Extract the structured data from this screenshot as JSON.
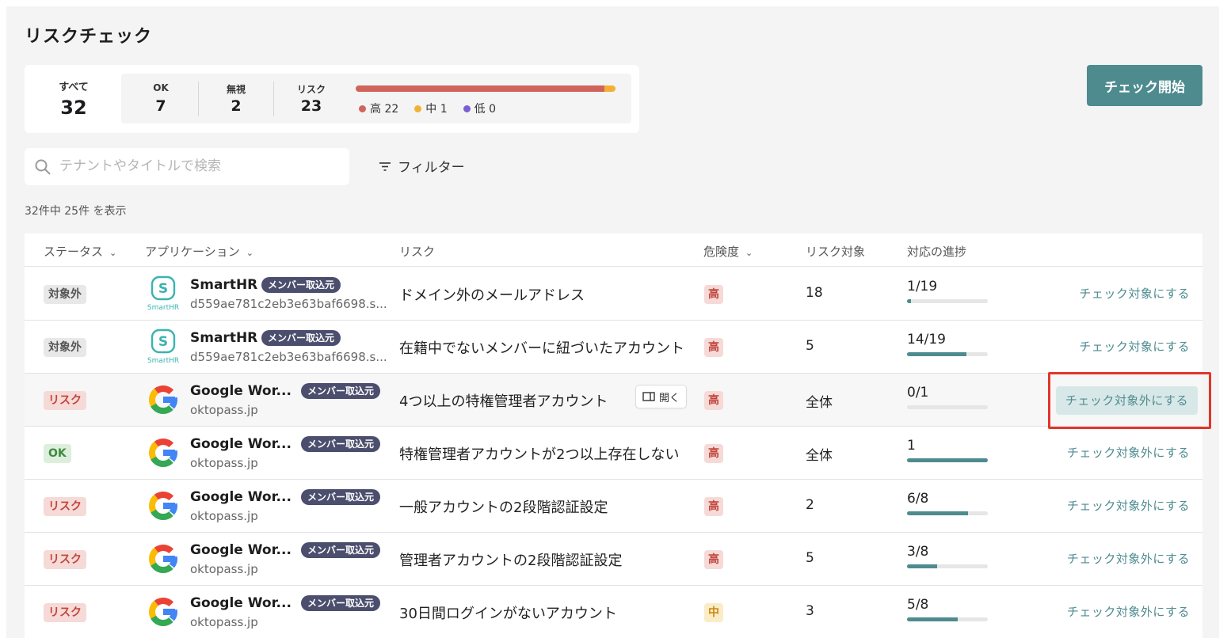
{
  "page": {
    "title": "リスクチェック"
  },
  "summary": {
    "total": {
      "label": "すべて",
      "value": "32"
    },
    "ok": {
      "label": "OK",
      "value": "7"
    },
    "ignored": {
      "label": "無視",
      "value": "2"
    },
    "risk": {
      "label": "リスク",
      "value": "23"
    },
    "risk_breakdown": {
      "high": 22,
      "medium": 1,
      "low": 0
    },
    "legend": {
      "high": "高 22",
      "medium": "中 1",
      "low": "低 0"
    },
    "colors": {
      "high": "#d0645b",
      "medium": "#f2b134",
      "low": "#7a5fd0"
    }
  },
  "toolbar": {
    "start_button": "チェック開始",
    "search_placeholder": "テナントやタイトルで検索",
    "filter_label": "フィルター",
    "result_count": "32件中 25件 を表示"
  },
  "table": {
    "headers": {
      "status": "ステータス",
      "application": "アプリケーション",
      "risk": "リスク",
      "severity": "危険度",
      "target": "リスク対象",
      "progress": "対応の進捗"
    },
    "open_button": "開く",
    "rows": [
      {
        "status": "対象外",
        "status_type": "out",
        "app": "SmartHR",
        "logo": "smarthr",
        "badge": "メンバー取込元",
        "tenant": "d559ae781c2eb3e63baf6698.s...",
        "risk": "ドメイン外のメールアドレス",
        "severity": "高",
        "severity_type": "hi",
        "target": "18",
        "progress": "1/19",
        "progress_ratio": 0.0526,
        "action": "チェック対象にする"
      },
      {
        "status": "対象外",
        "status_type": "out",
        "app": "SmartHR",
        "logo": "smarthr",
        "badge": "メンバー取込元",
        "tenant": "d559ae781c2eb3e63baf6698.s...",
        "risk": "在籍中でないメンバーに紐づいたアカウント",
        "severity": "高",
        "severity_type": "hi",
        "target": "5",
        "progress": "14/19",
        "progress_ratio": 0.737,
        "action": "チェック対象にする"
      },
      {
        "status": "リスク",
        "status_type": "risk",
        "app": "Google Wor...",
        "logo": "google",
        "badge": "メンバー取込元",
        "tenant": "oktopass.jp",
        "risk": "4つ以上の特権管理者アカウント",
        "severity": "高",
        "severity_type": "hi",
        "target": "全体",
        "progress": "0/1",
        "progress_ratio": 0,
        "action": "チェック対象外にする"
      },
      {
        "status": "OK",
        "status_type": "ok",
        "app": "Google Wor...",
        "logo": "google",
        "badge": "メンバー取込元",
        "tenant": "oktopass.jp",
        "risk": "特権管理者アカウントが2つ以上存在しない",
        "severity": "高",
        "severity_type": "hi",
        "target": "全体",
        "progress": "1",
        "progress_ratio": 1,
        "action": "チェック対象外にする"
      },
      {
        "status": "リスク",
        "status_type": "risk",
        "app": "Google Wor...",
        "logo": "google",
        "badge": "メンバー取込元",
        "tenant": "oktopass.jp",
        "risk": "一般アカウントの2段階認証設定",
        "severity": "高",
        "severity_type": "hi",
        "target": "2",
        "progress": "6/8",
        "progress_ratio": 0.75,
        "action": "チェック対象外にする"
      },
      {
        "status": "リスク",
        "status_type": "risk",
        "app": "Google Wor...",
        "logo": "google",
        "badge": "メンバー取込元",
        "tenant": "oktopass.jp",
        "risk": "管理者アカウントの2段階認証設定",
        "severity": "高",
        "severity_type": "hi",
        "target": "5",
        "progress": "3/8",
        "progress_ratio": 0.375,
        "action": "チェック対象外にする"
      },
      {
        "status": "リスク",
        "status_type": "risk",
        "app": "Google Wor...",
        "logo": "google",
        "badge": "メンバー取込元",
        "tenant": "oktopass.jp",
        "risk": "30日間ログインがないアカウント",
        "severity": "中",
        "severity_type": "mid",
        "target": "3",
        "progress": "5/8",
        "progress_ratio": 0.625,
        "action": "チェック対象外にする"
      }
    ]
  },
  "brand_color": "#4e8b8f"
}
